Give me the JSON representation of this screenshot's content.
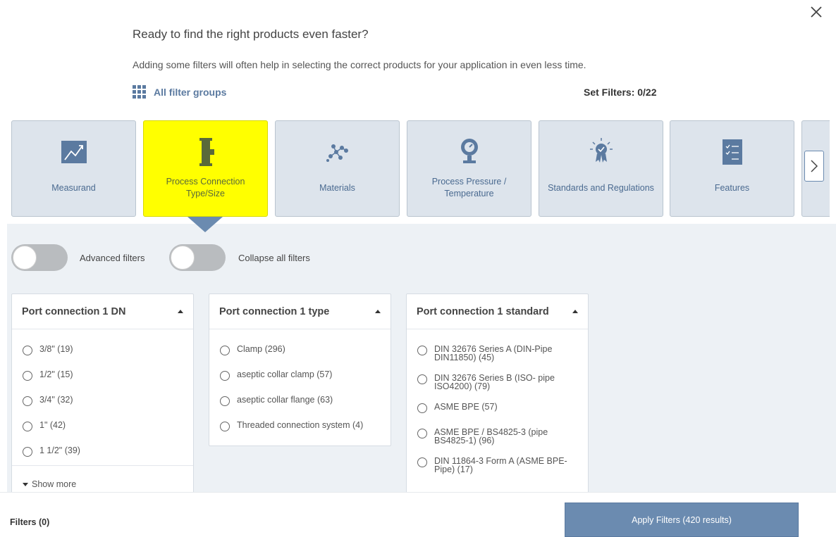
{
  "header": {
    "title": "Ready to find the right products even faster?",
    "subtitle": "Adding some filters will often help in selecting the correct products for your application in even less time.",
    "all_groups_label": "All filter groups",
    "set_filters": "Set Filters: 0/22"
  },
  "categories": [
    {
      "label": "Measurand",
      "icon": "chart-trend-icon"
    },
    {
      "label": "Process Connection Type/Size",
      "icon": "process-connection-icon",
      "active": true
    },
    {
      "label": "Materials",
      "icon": "molecule-icon"
    },
    {
      "label": "Process Pressure / Temperature",
      "icon": "pressure-gauge-icon"
    },
    {
      "label": "Standards and Regulations",
      "icon": "certificate-award-icon"
    },
    {
      "label": "Features",
      "icon": "checklist-icon"
    }
  ],
  "toggles": {
    "advanced": "Advanced filters",
    "collapse": "Collapse all filters"
  },
  "filters": [
    {
      "title": "Port connection 1 DN",
      "options": [
        "3/8\" (19)",
        "1/2\" (15)",
        "3/4\" (32)",
        "1\" (42)",
        "1 1/2\" (39)"
      ],
      "show_more": "Show more"
    },
    {
      "title": "Port connection 1 type",
      "options": [
        "Clamp (296)",
        "aseptic collar clamp (57)",
        "aseptic collar flange (63)",
        "Threaded connection system (4)"
      ]
    },
    {
      "title": "Port connection 1 standard",
      "options": [
        "DIN 32676 Series A (DIN-Pipe DIN11850) (45)",
        "DIN 32676 Series B (ISO- pipe ISO4200) (79)",
        "ASME BPE (57)",
        "ASME BPE / BS4825-3 (pipe BS4825-1) (96)",
        "DIN 11864-3 Form A (ASME BPE-Pipe) (17)"
      ]
    }
  ],
  "footer": {
    "filters_count": "Filters (0)",
    "apply_label": "Apply Filters (420 results)"
  },
  "colors": {
    "accent": "#6b8bb0",
    "active_card": "#ffff00",
    "card_bg": "#dde4ec",
    "panel_bg": "#edf1f5"
  }
}
